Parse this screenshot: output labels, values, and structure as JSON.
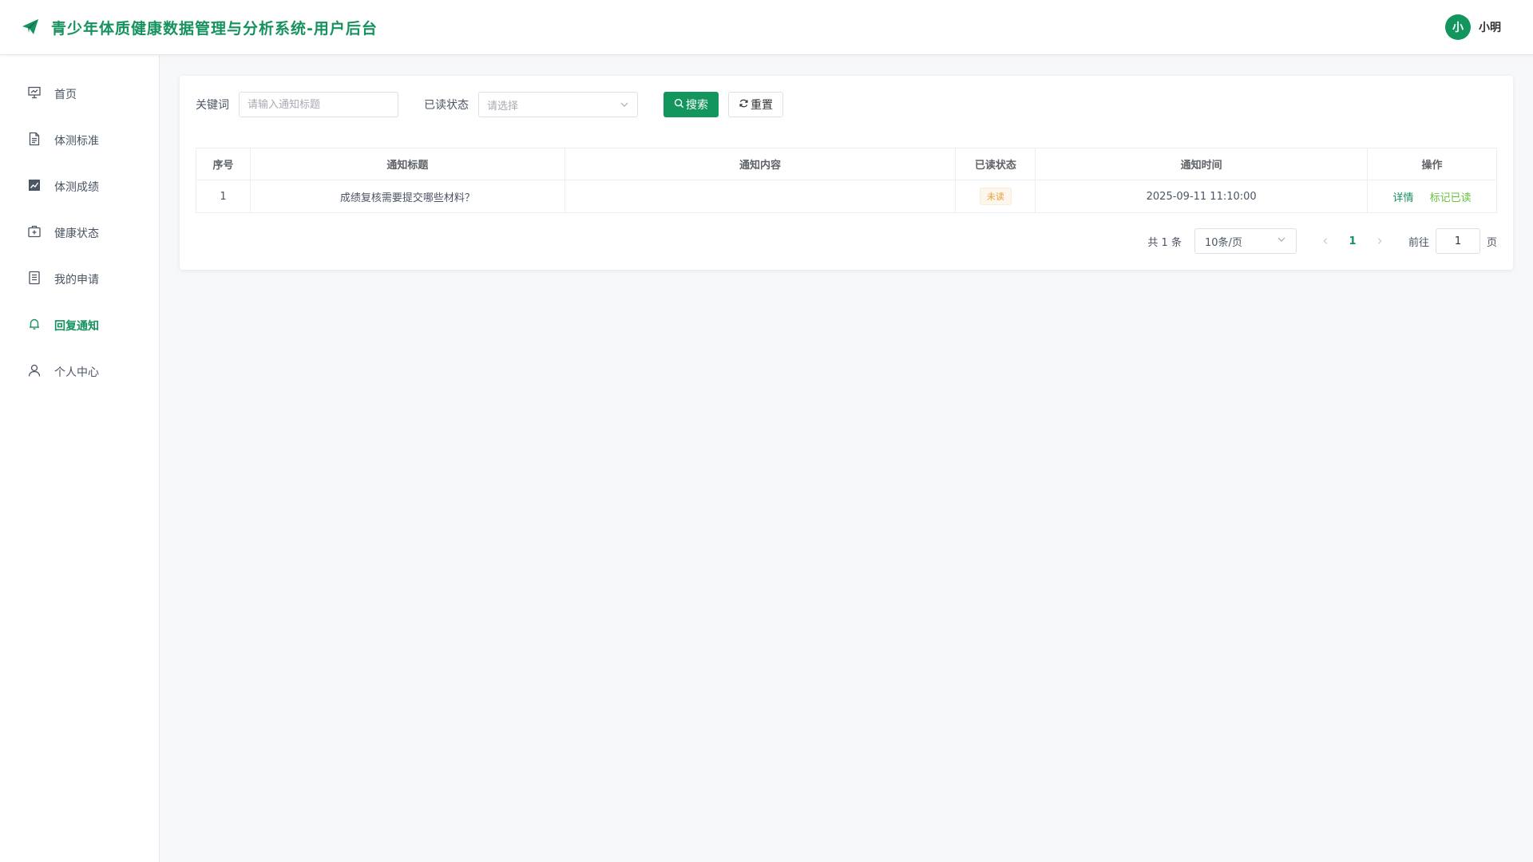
{
  "header": {
    "logo_icon": "paper-plane-icon",
    "title": "青少年体质健康数据管理与分析系统-用户后台",
    "avatar_text": "小",
    "username": "小明",
    "brand_color": "#15925e"
  },
  "sidebar": {
    "items": [
      {
        "label": "首页",
        "icon": "presentation-chart-icon",
        "active": false
      },
      {
        "label": "体测标准",
        "icon": "document-icon",
        "active": false
      },
      {
        "label": "体测成绩",
        "icon": "line-chart-icon",
        "active": false
      },
      {
        "label": "健康状态",
        "icon": "first-aid-kit-icon",
        "active": false
      },
      {
        "label": "我的申请",
        "icon": "list-document-icon",
        "active": false
      },
      {
        "label": "回复通知",
        "icon": "bell-icon",
        "active": true
      },
      {
        "label": "个人中心",
        "icon": "user-icon",
        "active": false
      }
    ]
  },
  "filters": {
    "keyword_label": "关键词",
    "keyword_placeholder": "请输入通知标题",
    "keyword_value": "",
    "status_label": "已读状态",
    "status_placeholder": "请选择",
    "search_label": "搜索",
    "reset_label": "重置"
  },
  "table": {
    "columns": [
      "序号",
      "通知标题",
      "通知内容",
      "已读状态",
      "通知时间",
      "操作"
    ],
    "rows": [
      {
        "index": "1",
        "title": "成绩复核需要提交哪些材料？",
        "content": "",
        "status": "未读",
        "time": "2025-09-11 11:10:00",
        "action_detail": "详情",
        "action_mark": "标记已读"
      }
    ]
  },
  "pagination": {
    "total_text": "共 1 条",
    "page_size": "10条/页",
    "current_page": "1",
    "goto_label": "前往",
    "goto_value": "1",
    "page_suffix": "页"
  }
}
